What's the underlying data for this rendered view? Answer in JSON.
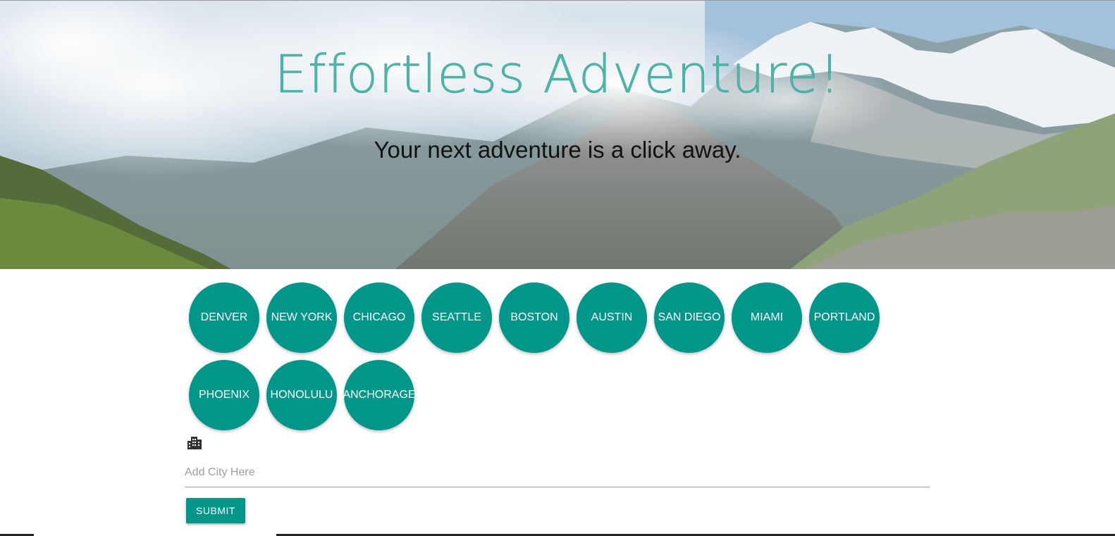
{
  "hero": {
    "title": "Effortless Adventure!",
    "subtitle": "Your next adventure is a click away."
  },
  "cities": [
    "DENVER",
    "NEW YORK",
    "CHICAGO",
    "SEATTLE",
    "BOSTON",
    "AUSTIN",
    "SAN DIEGO",
    "MIAMI",
    "PORTLAND",
    "PHOENIX",
    "HONOLULU",
    "ANCHORAGE"
  ],
  "form": {
    "icon": "city-icon",
    "placeholder": "Add City Here",
    "value": "",
    "submit_label": "SUBMIT"
  },
  "colors": {
    "accent": "#00968a",
    "title": "#4db6ac"
  }
}
